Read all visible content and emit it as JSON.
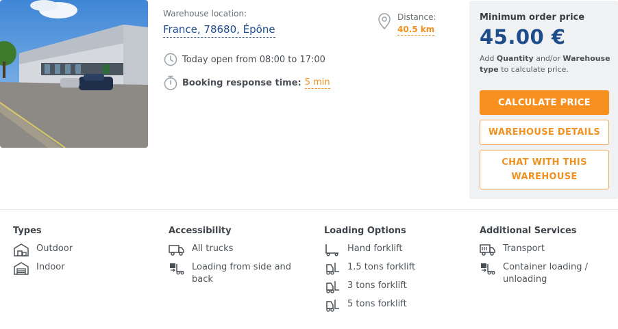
{
  "listing": {
    "location_label": "Warehouse location:",
    "location_value": "France, 78680, Épône",
    "hours_text": "Today open from 08:00 to 17:00",
    "booking_label": "Booking response time:",
    "booking_value": "5 min",
    "distance_label": "Distance:",
    "distance_value": "40.5 km"
  },
  "pricing": {
    "title": "Minimum order price",
    "price": "45.00 €",
    "note_prefix": "Add ",
    "note_quantity": "Quantity",
    "note_mid": " and/or ",
    "note_type": "Warehouse type",
    "note_suffix": " to calculate price.",
    "calculate_label": "CALCULATE PRICE",
    "details_label": "WAREHOUSE DETAILS",
    "chat_label": "CHAT WITH THIS WAREHOUSE"
  },
  "features": {
    "types": {
      "title": "Types",
      "items": [
        "Outdoor",
        "Indoor"
      ]
    },
    "accessibility": {
      "title": "Accessibility",
      "items": [
        "All trucks",
        "Loading from side and back"
      ]
    },
    "loading": {
      "title": "Loading Options",
      "items": [
        "Hand forklift",
        "1.5 tons forklift",
        "3 tons forklift",
        "5 tons forklift"
      ]
    },
    "services": {
      "title": "Additional Services",
      "items": [
        "Transport",
        "Container loading / unloading"
      ]
    }
  },
  "icons": {
    "outdoor": "outdoor-shed-icon",
    "indoor": "indoor-warehouse-icon",
    "trucks": "truck-icon",
    "side_loading": "side-loading-icon",
    "hand_forklift": "hand-forklift-icon",
    "forklift": "forklift-icon",
    "transport": "transport-truck-icon",
    "container": "container-loading-icon",
    "clock": "clock-icon",
    "timer": "stopwatch-icon",
    "pin": "location-pin-icon"
  },
  "colors": {
    "accent": "#f7901e",
    "brand_blue": "#1e4d8c",
    "panel": "#f0f1f2"
  }
}
